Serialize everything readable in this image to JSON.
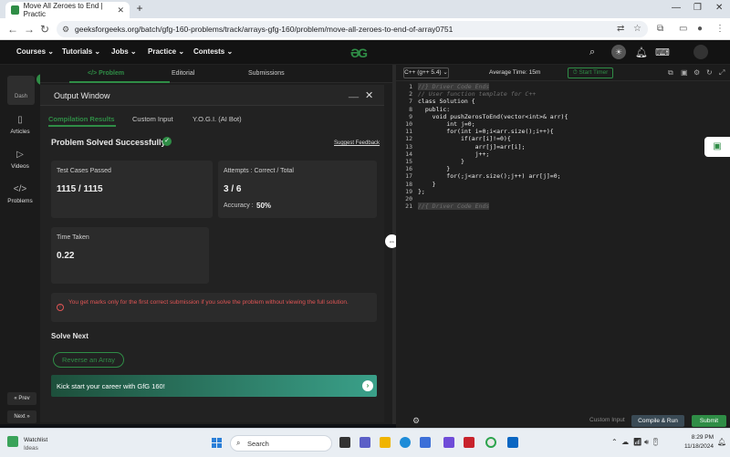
{
  "browser": {
    "tab_title": "Move All Zeroes to End | Practic",
    "tab_close": "✕",
    "new_tab": "+",
    "url": "geeksforgeeks.org/batch/gfg-160-problems/track/arrays-gfg-160/problem/move-all-zeroes-to-end-of-array0751",
    "back": "←",
    "forward": "→",
    "reload": "↻"
  },
  "site_nav": {
    "items": [
      "Courses ⌄",
      "Tutorials ⌄",
      "Jobs ⌄",
      "Practice ⌄",
      "Contests ⌄"
    ],
    "logo": "ƏG"
  },
  "sidebar": {
    "dash": "Dash",
    "items": [
      "Articles",
      "Videos",
      "Problems"
    ],
    "prev": "« Prev",
    "next": "Next »"
  },
  "problem_tabs": [
    "</> Problem",
    "Editorial",
    "Submissions"
  ],
  "output_window": {
    "title": "Output Window",
    "minimize": "__",
    "close": "✕",
    "tabs": [
      "Compilation Results",
      "Custom Input",
      "Y.O.G.I. (AI Bot)"
    ],
    "status": "Problem Solved Successfully",
    "suggest_feedback": "Suggest Feedback",
    "cards": {
      "test_cases_label": "Test Cases Passed",
      "test_cases_value": "1115 / 1115",
      "attempts_label": "Attempts : Correct / Total",
      "attempts_value": "3 / 6",
      "accuracy_label": "Accuracy :",
      "accuracy_value": "50%",
      "time_label": "Time Taken",
      "time_value": "0.22"
    },
    "alert": "You get marks only for the first correct submission if you solve the problem without viewing the full solution.",
    "solve_next": "Solve Next",
    "next_chip": "Reverse an Array",
    "career_banner": "Kick start your career with GfG 160!"
  },
  "editor": {
    "language": "C++ (g++ 5.4) ⌄",
    "avg_time": "Average Time: 15m",
    "timer": "⏱ Start Timer",
    "line_numbers": [
      "1",
      "2",
      "7",
      "8",
      "9",
      "10",
      "11",
      "12",
      "13",
      "14",
      "15",
      "16",
      "17",
      "18",
      "19",
      "20",
      "21"
    ],
    "lines": [
      {
        "t": "//} Driver Code Ends",
        "c": "cm hl1"
      },
      {
        "t": "// User function template for C++",
        "c": "cm"
      },
      {
        "t": "class Solution {",
        "c": ""
      },
      {
        "t": "  public:",
        "c": ""
      },
      {
        "t": "    void pushZerosToEnd(vector<int>& arr){",
        "c": ""
      },
      {
        "t": "        int j=0;",
        "c": ""
      },
      {
        "t": "        for(int i=0;i<arr.size();i++){",
        "c": ""
      },
      {
        "t": "            if(arr[i]!=0){",
        "c": ""
      },
      {
        "t": "                arr[j]=arr[i];",
        "c": ""
      },
      {
        "t": "                j++;",
        "c": ""
      },
      {
        "t": "            }",
        "c": ""
      },
      {
        "t": "        }",
        "c": ""
      },
      {
        "t": "        for(;j<arr.size();j++) arr[j]=0;",
        "c": ""
      },
      {
        "t": "    }",
        "c": ""
      },
      {
        "t": "};",
        "c": ""
      },
      {
        "t": "//{ Driver Code Ends",
        "c": "cm hl1"
      }
    ],
    "custom_input": "Custom Input",
    "compile_run": "Compile & Run",
    "submit": "Submit"
  },
  "taskbar": {
    "weather_title": "Watchlist",
    "weather_sub": "Ideas",
    "search": "Search",
    "time": "8:29 PM",
    "date": "11/18/2024"
  },
  "colors": {
    "accent": "#2f8d46",
    "error": "#e05555"
  }
}
